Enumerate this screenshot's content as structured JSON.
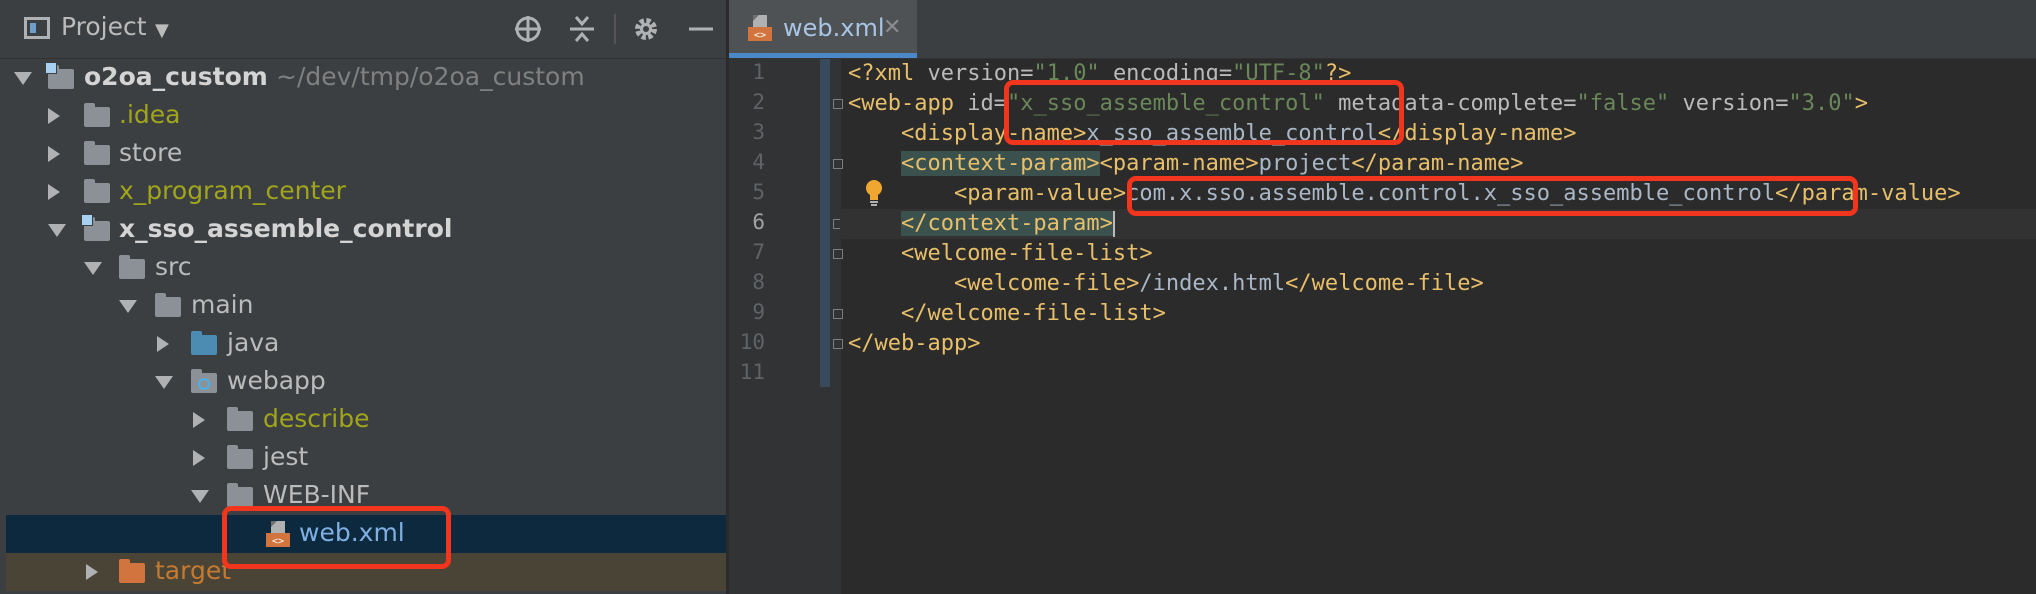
{
  "project_panel": {
    "title": "Project",
    "dropdown_glyph": "▼",
    "header_icons": [
      "crosshair-icon",
      "collapse-icon",
      "gear-icon",
      "minimize-icon"
    ],
    "tree": [
      {
        "label": "o2oa_custom",
        "path": "~/dev/tmp/o2oa_custom",
        "expanded": true,
        "type": "module"
      },
      {
        "label": ".idea",
        "expanded": false,
        "type": "folder"
      },
      {
        "label": "store",
        "expanded": false,
        "type": "folder"
      },
      {
        "label": "x_program_center",
        "expanded": false,
        "type": "folder"
      },
      {
        "label": "x_sso_assemble_control",
        "expanded": true,
        "type": "module"
      },
      {
        "label": "src",
        "expanded": true,
        "type": "folder"
      },
      {
        "label": "main",
        "expanded": true,
        "type": "folder"
      },
      {
        "label": "java",
        "expanded": false,
        "type": "source-folder"
      },
      {
        "label": "webapp",
        "expanded": true,
        "type": "web-folder"
      },
      {
        "label": "describe",
        "expanded": false,
        "type": "folder"
      },
      {
        "label": "jest",
        "expanded": false,
        "type": "folder"
      },
      {
        "label": "WEB-INF",
        "expanded": true,
        "type": "folder"
      },
      {
        "label": "web.xml",
        "type": "xml-file",
        "selected": true
      },
      {
        "label": "target",
        "expanded": false,
        "type": "excluded-folder"
      }
    ]
  },
  "editor": {
    "tab_label": "web.xml",
    "tab_close": "✕",
    "current_line": 6,
    "line_numbers": [
      "1",
      "2",
      "3",
      "4",
      "5",
      "6",
      "7",
      "8",
      "9",
      "10",
      "11"
    ],
    "code": {
      "l1": {
        "a": "<?xml ",
        "b": "version",
        "c": "=",
        "d": "\"1.0\"",
        "e": " ",
        "f": "encoding",
        "g": "=",
        "h": "\"UTF-8\"",
        "i": "?>"
      },
      "l2": {
        "a": "<web-app ",
        "b": "id",
        "c": "=",
        "d": "\"x_sso_assemble_control\"",
        "e": " ",
        "f": "metadata-complete",
        "g": "=",
        "h": "\"false\"",
        "i": " ",
        "j": "version",
        "k": "=",
        "l": "\"3.0\"",
        "m": ">"
      },
      "l3": {
        "indent": "    ",
        "a": "<display-name>",
        "b": "x_sso_assemble_control",
        "c": "</display-name>"
      },
      "l4": {
        "indent": "    ",
        "a": "<context-param>",
        "b": "<param-name>",
        "c": "project",
        "d": "</param-name>"
      },
      "l5": {
        "indent": "        ",
        "a": "<param-value>",
        "b": "com.x.sso.assemble.control.x_sso_assemble_control",
        "c": "</param-value>"
      },
      "l6": {
        "indent": "    ",
        "a": "</context-param>"
      },
      "l7": {
        "indent": "    ",
        "a": "<welcome-file-list>"
      },
      "l8": {
        "indent": "        ",
        "a": "<welcome-file>",
        "b": "/index.html",
        "c": "</welcome-file>"
      },
      "l9": {
        "indent": "    ",
        "a": "</welcome-file-list>"
      },
      "l10": {
        "a": "</web-app>"
      },
      "l11": {
        "a": ""
      }
    }
  },
  "colors": {
    "tag": "#e8bf6a",
    "attribute_value": "#6a8759",
    "annotation": "#f1361d",
    "selection": "#0d293e"
  }
}
